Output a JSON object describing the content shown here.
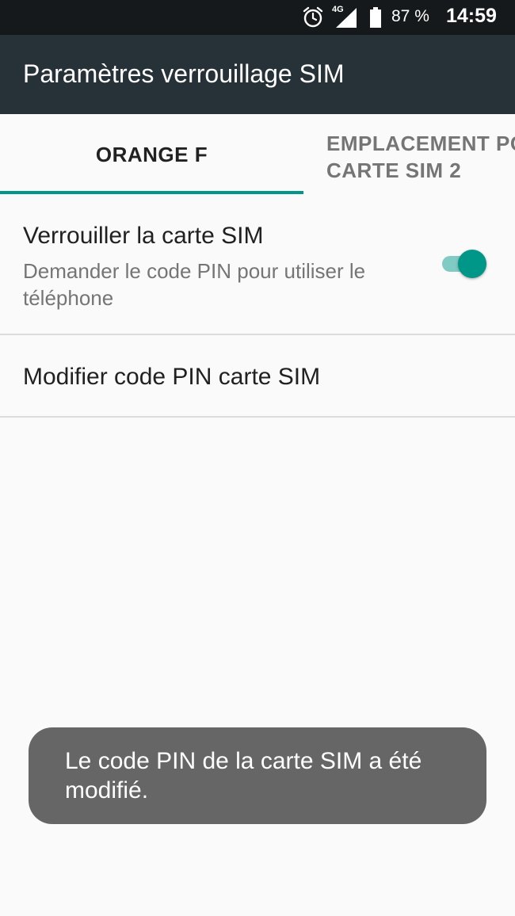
{
  "status_bar": {
    "alarm_icon": "alarm-clock-icon",
    "network_label": "4G",
    "signal_icon": "cell-signal-icon",
    "battery_icon": "battery-icon",
    "battery_percent": "87 %",
    "time": "14:59"
  },
  "app_bar": {
    "title": "Paramètres verrouillage SIM",
    "background": "#263238"
  },
  "tabs": [
    {
      "label": "ORANGE F",
      "selected": true
    },
    {
      "label_lines": [
        "EMPLACEMENT PO",
        "CARTE SIM 2"
      ],
      "selected": false
    }
  ],
  "preferences": {
    "lock_sim": {
      "title": "Verrouiller la carte SIM",
      "summary": "Demander le code PIN pour utiliser le téléphone",
      "switch_on": true
    },
    "change_pin": {
      "title": "Modifier code PIN carte SIM"
    }
  },
  "toast": {
    "message": "Le code PIN de la carte SIM a été modifié."
  },
  "colors": {
    "accent": "#009688",
    "accent_light": "#80cbc4",
    "toast_bg": "#666666"
  }
}
